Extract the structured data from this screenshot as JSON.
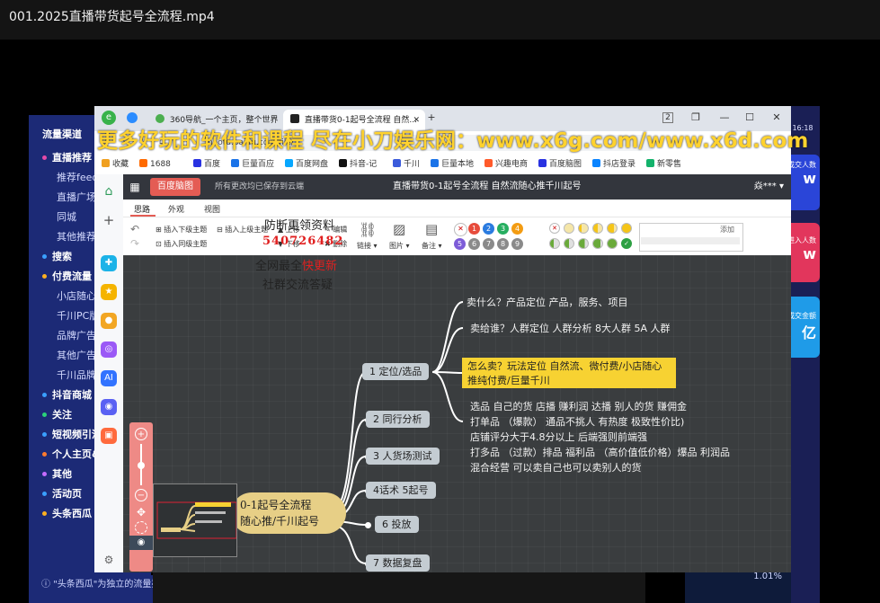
{
  "player": {
    "title": "001.2025直播带货起号全流程.mp4"
  },
  "bg_dashboard": {
    "left_items": [
      {
        "label": "流量渠道",
        "type": "header"
      },
      {
        "label": "直播推荐",
        "type": "group",
        "dot": "#e54aa8"
      },
      {
        "label": "推荐feed",
        "type": "sub"
      },
      {
        "label": "直播广场",
        "type": "sub"
      },
      {
        "label": "同城",
        "type": "sub"
      },
      {
        "label": "其他推荐",
        "type": "sub"
      },
      {
        "label": "搜索",
        "type": "group",
        "dot": "#3aa0ff"
      },
      {
        "label": "付费流量",
        "type": "group",
        "dot": "#ffb020"
      },
      {
        "label": "小店随心",
        "type": "sub"
      },
      {
        "label": "千川PC版",
        "type": "sub"
      },
      {
        "label": "品牌广告",
        "type": "sub"
      },
      {
        "label": "其他广告",
        "type": "sub"
      },
      {
        "label": "千川品牌",
        "type": "sub"
      },
      {
        "label": "抖音商城",
        "type": "group",
        "dot": "#3aa0ff"
      },
      {
        "label": "关注",
        "type": "group",
        "dot": "#2bd27a"
      },
      {
        "label": "短视频引流",
        "type": "group",
        "dot": "#3aa0ff"
      },
      {
        "label": "个人主页&",
        "type": "group",
        "dot": "#ff7b2e"
      },
      {
        "label": "其他",
        "type": "group",
        "dot": "#c56cff"
      },
      {
        "label": "活动页",
        "type": "group",
        "dot": "#3aa0ff"
      },
      {
        "label": "头条西瓜",
        "type": "group",
        "dot": "#ffb020"
      }
    ],
    "bottom_note": "\"头条西瓜\"为独立的流量渠道，不影响直播间在抖音的流量",
    "clock": "16:18",
    "right_cards": [
      {
        "label": "成交人数",
        "value": "w"
      },
      {
        "label": "进入人数",
        "value": "w"
      },
      {
        "label": "成交金额",
        "value": "亿"
      }
    ],
    "right_stats": [
      "%",
      "%",
      "%",
      "%",
      "1.01%"
    ]
  },
  "browser": {
    "tabs": [
      {
        "label": "360导航_一个主页，整个世界"
      },
      {
        "label": "直播带货0-1起号全流程  自然..."
      }
    ],
    "new_tab": "+",
    "window_controls": [
      "2",
      "❐",
      "—",
      "☐",
      "✕"
    ],
    "url": "naotu.baidu.com/file/...",
    "bookmarks": [
      {
        "label": "收藏",
        "color": "#f0a020"
      },
      {
        "label": "1688",
        "color": "#ff6a00"
      },
      {
        "label": "百度",
        "color": "#2932e1"
      },
      {
        "label": "巨量百应",
        "color": "#1a73e8"
      },
      {
        "label": "百度网盘",
        "color": "#06a7ff"
      },
      {
        "label": "抖音-记",
        "color": "#111111"
      },
      {
        "label": "千川",
        "color": "#3b5bdb"
      },
      {
        "label": "巨量本地",
        "color": "#1a73e8"
      },
      {
        "label": "兴趣电商",
        "color": "#ff5a2a"
      },
      {
        "label": "百度脑图",
        "color": "#2932e1"
      },
      {
        "label": "抖店登录",
        "color": "#0a84ff"
      },
      {
        "label": "新零售",
        "color": "#13b26b"
      }
    ]
  },
  "app": {
    "brand": "百度脑图",
    "save_status": "所有更改均已保存到云端",
    "doc_title": "直播带货0-1起号全流程   自然流随心推千川起号",
    "user": "焱*** ▾",
    "menu_tabs": [
      "思路",
      "外观",
      "视图"
    ],
    "toolbar": {
      "insert_child": "插入下级主题",
      "insert_parent": "插入上级主题",
      "insert_sibling": "插入同级主题",
      "move_up": "上移",
      "move_down": "下移",
      "edit": "编辑",
      "delete": "删除",
      "link": "链接",
      "image": "图片",
      "note": "备注",
      "tag_add": "添加",
      "priorities": [
        "1",
        "2",
        "3",
        "4",
        "5",
        "6",
        "7",
        "8",
        "9"
      ]
    }
  },
  "mindmap": {
    "root_line1": "0-1起号全流程",
    "root_line2": "随心推/千川起号",
    "branches": [
      {
        "label": "1 定位/选品"
      },
      {
        "label": "2 同行分析"
      },
      {
        "label": "3 人货场测试"
      },
      {
        "label": "4话术 5起号"
      },
      {
        "label": "6 投放"
      },
      {
        "label": "7 数据复盘"
      }
    ],
    "leaf1": "卖什么？产品定位 产品，服务、项目",
    "leaf2": "卖给谁？人群定位 人群分析 8大人群 5A 人群",
    "leaf3": "怎么卖？玩法定位 自然流、微付费/小店随心推纯付费/巨量千川",
    "leaf4_lines": [
      "选品  自己的货 店播 赚利润  达播 别人的货 赚佣金",
      "打单品  （爆款） 通品不挑人 有热度 极致性价比)",
      "店铺评分大于4.8分以上  后端强则前端强",
      "打多品  （过款）排品 福利品  （高价值低价格）爆品 利润品",
      "混合经营  可以卖自己也可以卖别人的货"
    ]
  },
  "watermark": {
    "main": "更多好玩的软件和课程 尽在小刀娱乐网：www.x6g.com/www.x6d.com",
    "line1": "防断更领资料",
    "line2": "540726482",
    "line3_a": "全网最全",
    "line3_b": "快更新",
    "line4": "社群交流答疑"
  }
}
